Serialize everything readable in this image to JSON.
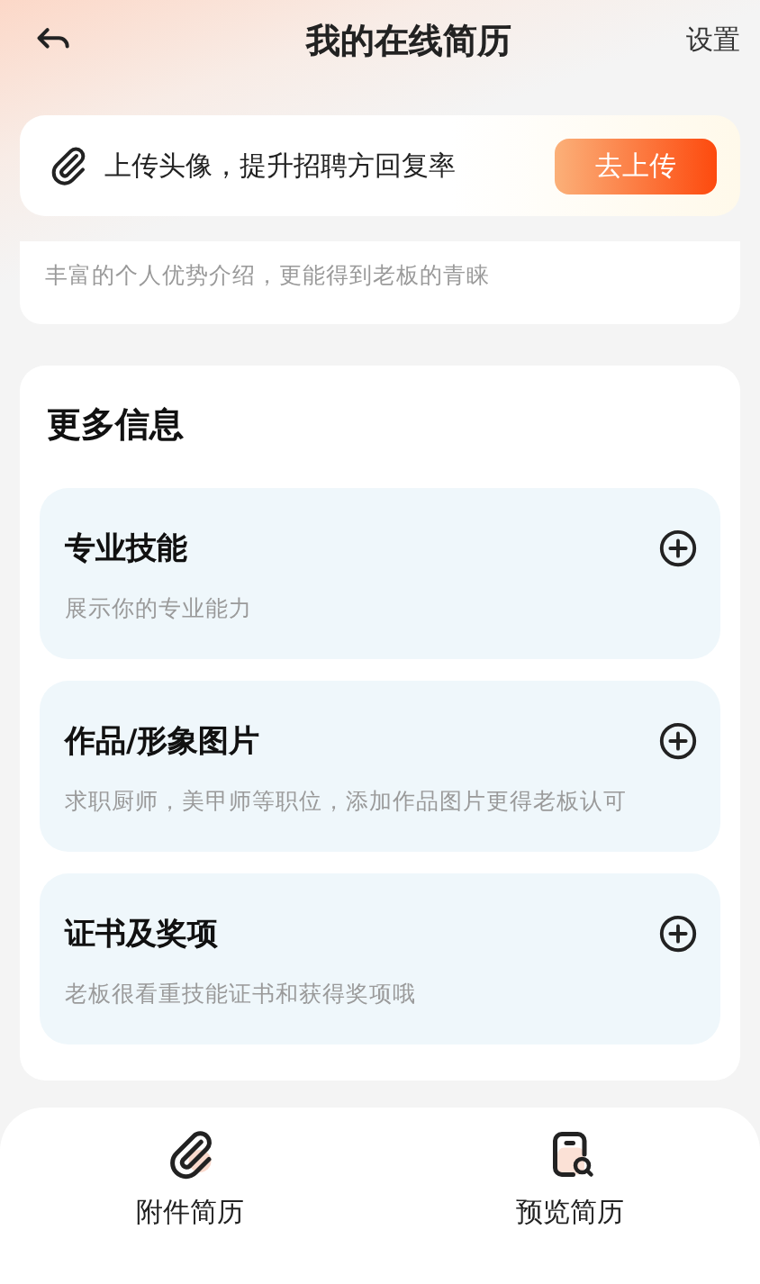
{
  "header": {
    "title": "我的在线简历",
    "action": "设置"
  },
  "upload_banner": {
    "text": "上传头像，提升招聘方回复率",
    "button": "去上传"
  },
  "intro_card": {
    "hint": "丰富的个人优势介绍，更能得到老板的青睐"
  },
  "more_info": {
    "title": "更多信息",
    "items": [
      {
        "title": "专业技能",
        "description": "展示你的专业能力"
      },
      {
        "title": "作品/形象图片",
        "description": "求职厨师，美甲师等职位，添加作品图片更得老板认可"
      },
      {
        "title": "证书及奖项",
        "description": "老板很看重技能证书和获得奖项哦"
      }
    ]
  },
  "bottom_nav": [
    {
      "kind": "attachment",
      "label": "附件简历"
    },
    {
      "kind": "preview",
      "label": "预览简历"
    }
  ]
}
